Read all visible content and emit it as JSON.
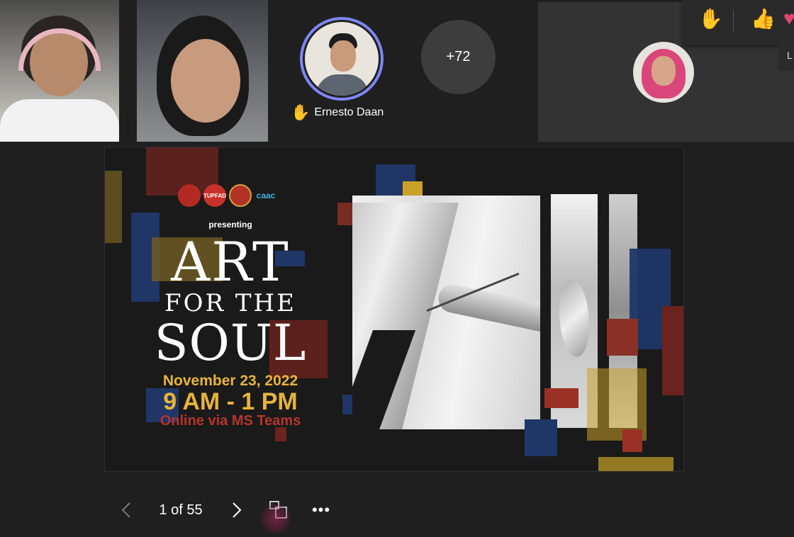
{
  "participants": {
    "raised_hand_name": "Ernesto Daan",
    "overflow_count": "+72"
  },
  "reactions": {
    "items": [
      "raise-hand",
      "like",
      "love"
    ],
    "tooltip": "L"
  },
  "slide": {
    "presenting": "presenting",
    "title_line1": "ART",
    "title_line2": "FOR THE",
    "title_line3": "SOUL",
    "date": "November 23, 2022",
    "time": "9 AM - 1 PM",
    "venue": "Online via MS Teams",
    "logos": [
      "seal",
      "TUPFAD",
      "crest",
      "caac"
    ]
  },
  "navigation": {
    "page_indicator": "1 of 55"
  },
  "colors": {
    "background": "#1f1f1f",
    "accent": "#7f85f5",
    "gold": "#e7b43a",
    "red": "#b6352b"
  }
}
